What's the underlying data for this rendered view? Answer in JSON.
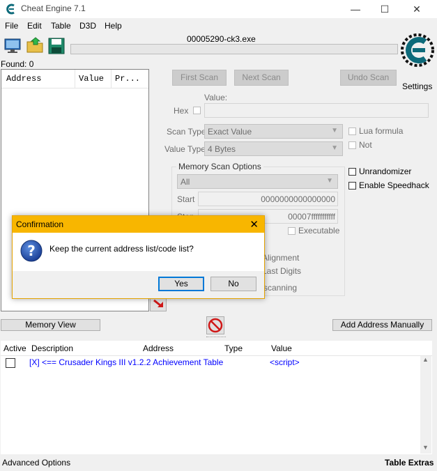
{
  "window": {
    "title": "Cheat Engine 7.1",
    "minimize_glyph": "—",
    "maximize_glyph": "☐",
    "close_glyph": "✕"
  },
  "menu": [
    "File",
    "Edit",
    "Table",
    "D3D",
    "Help"
  ],
  "toolbar": {
    "icons": [
      "computer-icon",
      "open-folder-icon",
      "save-icon"
    ]
  },
  "process_title": "00005290-ck3.exe",
  "found_label": "Found: 0",
  "results_list": {
    "columns": [
      "Address",
      "Value",
      "Pr..."
    ]
  },
  "scan": {
    "first_scan": "First Scan",
    "next_scan": "Next Scan",
    "undo_scan": "Undo Scan",
    "value_label": "Value:",
    "hex_label": "Hex",
    "scan_type_label": "Scan Type",
    "scan_type_value": "Exact Value",
    "value_type_label": "Value Type",
    "value_type_value": "4 Bytes",
    "lua_formula": "Lua formula",
    "not_label": "Not",
    "unrandomizer": "Unrandomizer",
    "enable_speedhack": "Enable Speedhack",
    "settings": "Settings"
  },
  "memory_options": {
    "title": "Memory Scan Options",
    "region_value": "All",
    "start_label": "Start",
    "start_value": "0000000000000000",
    "stop_label": "Stop",
    "stop_value": "00007fffffffffff",
    "executable": "Executable",
    "alignment": "Alignment",
    "last_digits": "Last Digits",
    "pause_scanning": "e scanning"
  },
  "bottom_buttons": {
    "memory_view": "Memory View",
    "add_address": "Add Address Manually"
  },
  "address_table": {
    "columns": [
      "Active",
      "Description",
      "Address",
      "Type",
      "Value"
    ],
    "rows": [
      {
        "description": "[X] <== Crusader Kings III v1.2.2 Achievement Table",
        "address": "",
        "type": "",
        "value": "<script>"
      }
    ]
  },
  "statusbar": {
    "left": "Advanced Options",
    "right": "Table Extras"
  },
  "dialog": {
    "title": "Confirmation",
    "message": "Keep the current address list/code list?",
    "yes": "Yes",
    "no": "No",
    "close_glyph": "✕"
  },
  "colors": {
    "dialog_accent": "#f8b600",
    "link_blue": "#0000ff",
    "logo_teal": "#0d6a7a"
  }
}
